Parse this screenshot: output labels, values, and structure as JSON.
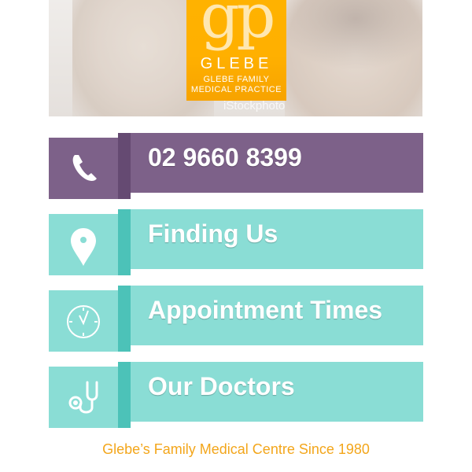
{
  "hero": {
    "logo_mark": "gp",
    "logo_name": "GLEBE",
    "logo_sub_1": "GLEBE FAMILY",
    "logo_sub_2": "MEDICAL PRACTICE",
    "watermark": "iStockphoto"
  },
  "menu": [
    {
      "label": "02 9660 8399",
      "icon": "phone-icon"
    },
    {
      "label": "Finding Us",
      "icon": "location-pin-icon"
    },
    {
      "label": "Appointment Times",
      "icon": "clock-icon"
    },
    {
      "label": "Our Doctors",
      "icon": "stethoscope-icon"
    }
  ],
  "footer": {
    "text": "Glebe’s Family Medical Centre Since 1980"
  },
  "colors": {
    "purple": "#7d6189",
    "teal": "#8addd5",
    "orange": "#ffb200",
    "footer_text": "#f3a61b"
  }
}
